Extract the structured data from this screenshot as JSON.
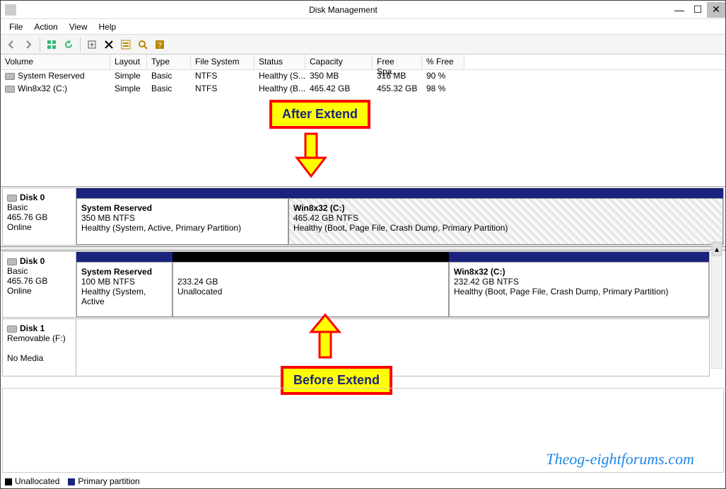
{
  "window": {
    "title": "Disk Management"
  },
  "menu": {
    "file": "File",
    "action": "Action",
    "view": "View",
    "help": "Help"
  },
  "columns": {
    "volume": "Volume",
    "layout": "Layout",
    "type": "Type",
    "fs": "File System",
    "status": "Status",
    "capacity": "Capacity",
    "free": "Free Spa...",
    "pctfree": "% Free"
  },
  "volumes": [
    {
      "name": "System Reserved",
      "layout": "Simple",
      "type": "Basic",
      "fs": "NTFS",
      "status": "Healthy (S...",
      "capacity": "350 MB",
      "free": "316 MB",
      "pct": "90 %"
    },
    {
      "name": "Win8x32 (C:)",
      "layout": "Simple",
      "type": "Basic",
      "fs": "NTFS",
      "status": "Healthy (B...",
      "capacity": "465.42 GB",
      "free": "455.32 GB",
      "pct": "98 %"
    }
  ],
  "after": {
    "disk": {
      "name": "Disk 0",
      "type": "Basic",
      "size": "465.76 GB",
      "state": "Online"
    },
    "p1": {
      "title": "System Reserved",
      "sub": "350 MB NTFS",
      "desc": "Healthy (System, Active, Primary Partition)"
    },
    "p2": {
      "title": "Win8x32  (C:)",
      "sub": "465.42 GB NTFS",
      "desc": "Healthy (Boot, Page File, Crash Dump, Primary Partition)"
    }
  },
  "before": {
    "disk": {
      "name": "Disk 0",
      "type": "Basic",
      "size": "465.76 GB",
      "state": "Online"
    },
    "p1": {
      "title": "System Reserved",
      "sub": "100 MB NTFS",
      "desc": "Healthy (System, Active"
    },
    "p2": {
      "sub": "233.24 GB",
      "desc": "Unallocated"
    },
    "p3": {
      "title": "Win8x32  (C:)",
      "sub": "232.42 GB NTFS",
      "desc": "Healthy (Boot, Page File, Crash Dump, Primary Partition)"
    }
  },
  "disk1": {
    "name": "Disk 1",
    "type": "Removable (F:)",
    "state": "No Media"
  },
  "annotations": {
    "after_label": "After Extend",
    "before_label": "Before Extend"
  },
  "legend": {
    "unalloc": "Unallocated",
    "primary": "Primary partition"
  },
  "watermark": "Theog-eightforums.com"
}
